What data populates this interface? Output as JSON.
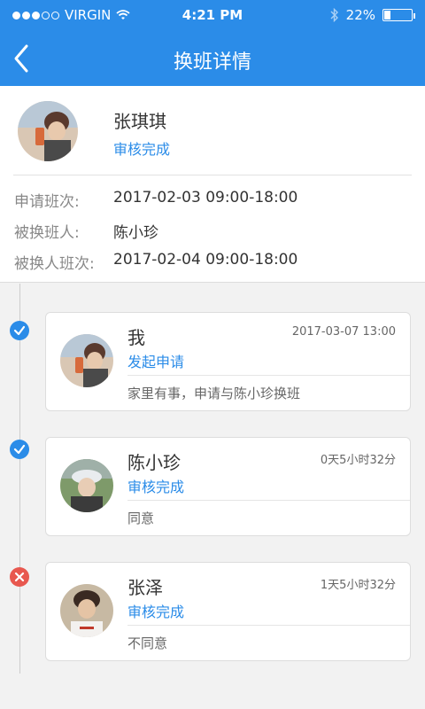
{
  "status_bar": {
    "carrier": "VIRGIN",
    "time": "4:21 PM",
    "battery": "22%"
  },
  "nav": {
    "title": "换班详情"
  },
  "applicant": {
    "name": "张琪琪",
    "status": "审核完成"
  },
  "details": [
    {
      "label": "申请班次:",
      "value": "2017-02-03 09:00-18:00"
    },
    {
      "label": "被换班人:",
      "value": "陈小珍"
    },
    {
      "label": "被换人班次:",
      "value": "2017-02-04 09:00-18:00"
    }
  ],
  "timeline": [
    {
      "state": "approved",
      "name": "我",
      "time": "2017-03-07 13:00",
      "status": "发起申请",
      "note": "家里有事，申请与陈小珍换班"
    },
    {
      "state": "approved",
      "name": "陈小珍",
      "time": "0天5小时32分",
      "status": "审核完成",
      "note": "同意"
    },
    {
      "state": "rejected",
      "name": "张泽",
      "time": "1天5小时32分",
      "status": "审核完成",
      "note": "不同意"
    }
  ]
}
